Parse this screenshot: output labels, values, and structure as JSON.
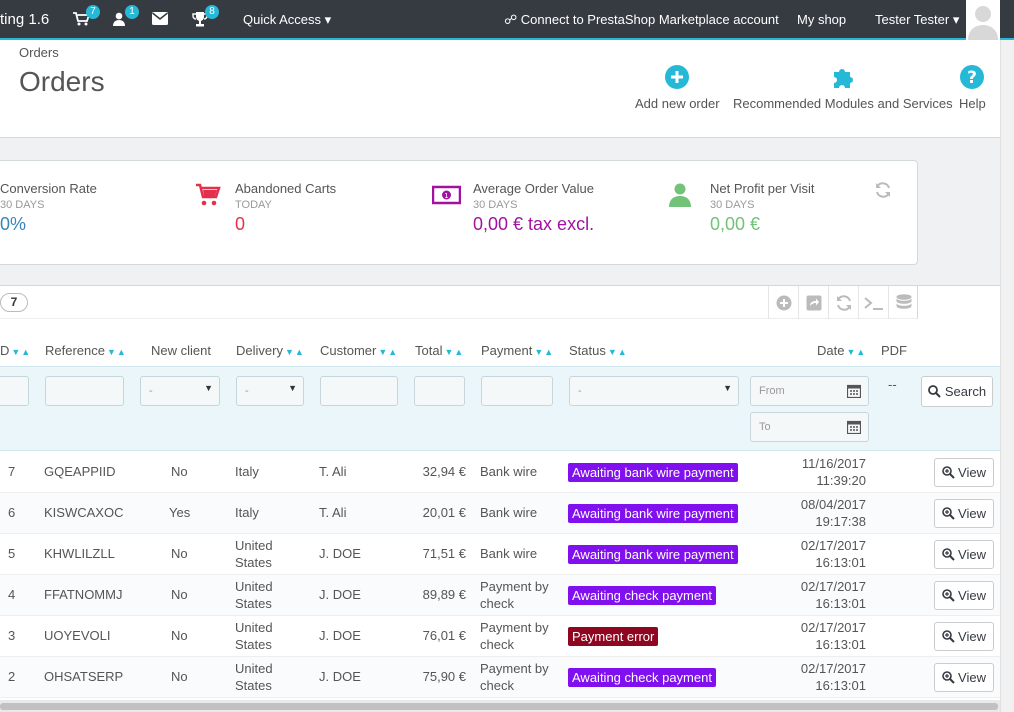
{
  "topbar": {
    "brand": "ting 1.6",
    "orders_badge": "7",
    "customers_badge": "1",
    "trophy_badge": "8",
    "quick_access": "Quick Access",
    "connect": "Connect to PrestaShop Marketplace account",
    "my_shop": "My shop",
    "user_name": "Tester Tester"
  },
  "header": {
    "breadcrumb": "Orders",
    "title": "Orders",
    "toolbar": {
      "add_new_order": "Add new order",
      "recommended": "Recommended Modules and Services",
      "help": "Help"
    }
  },
  "kpis": [
    {
      "label": "Conversion Rate",
      "period": "30 DAYS",
      "value": "0%",
      "color": "#3586bb"
    },
    {
      "label": "Abandoned Carts",
      "period": "TODAY",
      "value": "0",
      "color": "#e3304b"
    },
    {
      "label": "Average Order Value",
      "period": "30 DAYS",
      "value": "0,00 € tax excl.",
      "color": "#a212a2"
    },
    {
      "label": "Net Profit per Visit",
      "period": "30 DAYS",
      "value": "0,00 €",
      "color": "#72c279"
    }
  ],
  "table": {
    "count": "7",
    "columns": {
      "id": "D",
      "reference": "Reference",
      "new_client": "New client",
      "delivery": "Delivery",
      "customer": "Customer",
      "total": "Total",
      "payment": "Payment",
      "status": "Status",
      "date": "Date",
      "pdf": "PDF"
    },
    "filters": {
      "new_client_selected": "-",
      "delivery_selected": "-",
      "status_selected": "-",
      "date_from_placeholder": "From",
      "date_to_placeholder": "To",
      "pdf_dash": "--",
      "search": "Search"
    },
    "rows": [
      {
        "id": "7",
        "reference": "GQEAPPIID",
        "new_client": "No",
        "delivery": "Italy",
        "customer": "T. Ali",
        "total": "32,94 €",
        "payment": "Bank wire",
        "status": "Awaiting bank wire payment",
        "status_color": "#8011ee",
        "date": "11/16/2017",
        "time": "11:39:20",
        "view": "View"
      },
      {
        "id": "6",
        "reference": "KISWCAXOC",
        "new_client": "Yes",
        "delivery": "Italy",
        "customer": "T. Ali",
        "total": "20,01 €",
        "payment": "Bank wire",
        "status": "Awaiting bank wire payment",
        "status_color": "#8011ee",
        "date": "08/04/2017",
        "time": "19:17:38",
        "view": "View"
      },
      {
        "id": "5",
        "reference": "KHWLILZLL",
        "new_client": "No",
        "delivery": "United States",
        "customer": "J. DOE",
        "total": "71,51 €",
        "payment": "Bank wire",
        "status": "Awaiting bank wire payment",
        "status_color": "#8011ee",
        "date": "02/17/2017",
        "time": "16:13:01",
        "view": "View"
      },
      {
        "id": "4",
        "reference": "FFATNOMMJ",
        "new_client": "No",
        "delivery": "United States",
        "customer": "J. DOE",
        "total": "89,89 €",
        "payment": "Payment by check",
        "status": "Awaiting check payment",
        "status_color": "#8011ee",
        "date": "02/17/2017",
        "time": "16:13:01",
        "view": "View"
      },
      {
        "id": "3",
        "reference": "UOYEVOLI",
        "new_client": "No",
        "delivery": "United States",
        "customer": "J. DOE",
        "total": "76,01 €",
        "payment": "Payment by check",
        "status": "Payment error",
        "status_color": "#8f0621",
        "date": "02/17/2017",
        "time": "16:13:01",
        "view": "View"
      },
      {
        "id": "2",
        "reference": "OHSATSERP",
        "new_client": "No",
        "delivery": "United States",
        "customer": "J. DOE",
        "total": "75,90 €",
        "payment": "Payment by check",
        "status": "Awaiting check payment",
        "status_color": "#8011ee",
        "date": "02/17/2017",
        "time": "16:13:01",
        "view": "View"
      }
    ]
  }
}
